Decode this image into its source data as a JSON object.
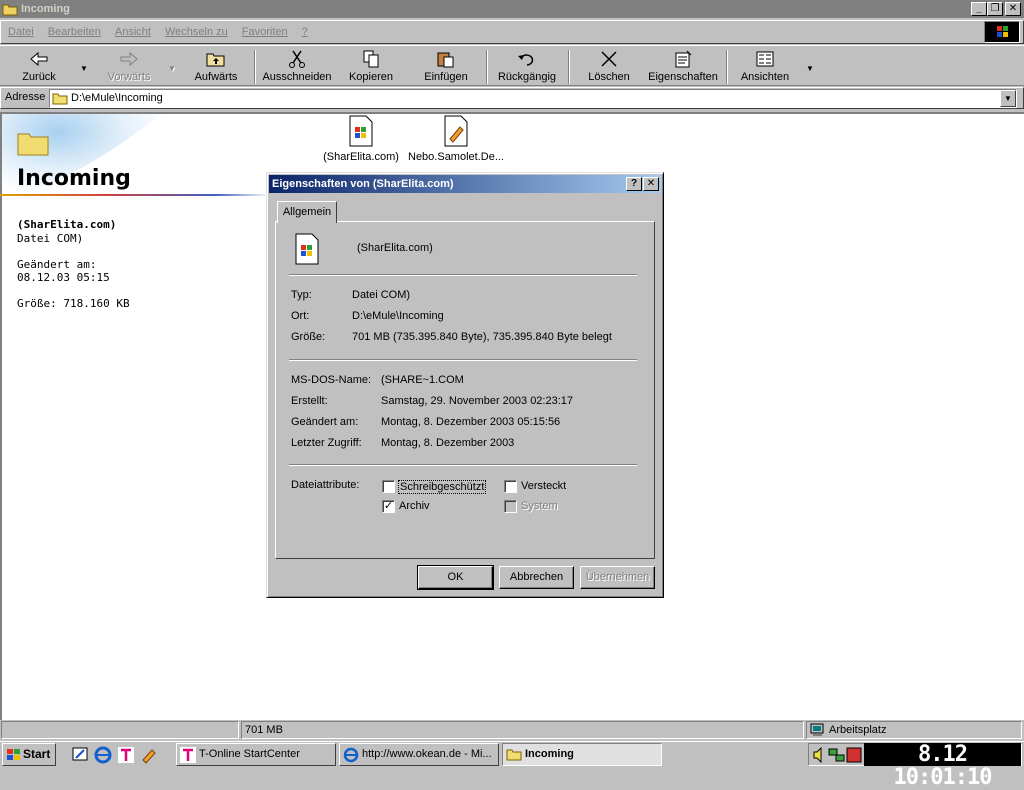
{
  "window": {
    "title": "Incoming"
  },
  "menu": [
    "Datei",
    "Bearbeiten",
    "Ansicht",
    "Wechseln zu",
    "Favoriten",
    "?"
  ],
  "toolbar": {
    "back": "Zurück",
    "forward": "Vorwärts",
    "up": "Aufwärts",
    "cut": "Ausschneiden",
    "copy": "Kopieren",
    "paste": "Einfügen",
    "undo": "Rückgängig",
    "delete": "Löschen",
    "properties": "Eigenschaften",
    "views": "Ansichten"
  },
  "address": {
    "label": "Adresse",
    "value": "D:\\eMule\\Incoming"
  },
  "left_panel": {
    "folder_title": "Incoming",
    "file_name": "(SharElita.com)",
    "file_type": "Datei COM)",
    "modified_label": "Geändert am:",
    "modified_value": "08.12.03 05:15",
    "size": "Größe: 718.160 KB"
  },
  "files": [
    {
      "name": "(SharElita.com)"
    },
    {
      "name": "Nebo.Samolet.De..."
    }
  ],
  "dialog": {
    "title": "Eigenschaften von   (SharElita.com)",
    "tab": "Allgemein",
    "file_name": "(SharElita.com)",
    "rows1": [
      {
        "label": "Typ:",
        "value": "Datei COM)"
      },
      {
        "label": "Ort:",
        "value": "D:\\eMule\\Incoming"
      },
      {
        "label": "Größe:",
        "value": "701 MB (735.395.840 Byte), 735.395.840 Byte belegt"
      }
    ],
    "rows2": [
      {
        "label": "MS-DOS-Name:",
        "value": "(SHARE~1.COM"
      },
      {
        "label": "Erstellt:",
        "value": "Samstag, 29. November 2003 02:23:17"
      },
      {
        "label": "Geändert am:",
        "value": "Montag, 8. Dezember 2003 05:15:56"
      },
      {
        "label": "Letzter Zugriff:",
        "value": "Montag, 8. Dezember 2003"
      }
    ],
    "attributes_label": "Dateiattribute:",
    "attr_readonly": "Schreibgeschützt",
    "attr_hidden": "Versteckt",
    "attr_archive": "Archiv",
    "attr_system": "System",
    "ok": "OK",
    "cancel": "Abbrechen",
    "apply": "Übernehmen"
  },
  "statusbar": {
    "size": "701 MB",
    "location": "Arbeitsplatz"
  },
  "taskbar": {
    "start": "Start",
    "tasks": [
      "T-Online StartCenter",
      "http://www.okean.de - Mi...",
      "Incoming"
    ],
    "clock": "8.12 10:01:10"
  }
}
